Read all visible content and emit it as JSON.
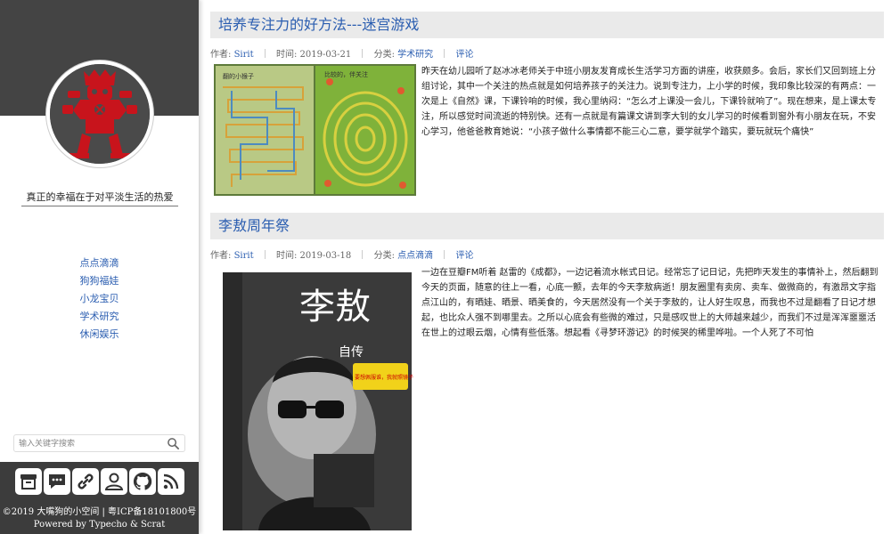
{
  "sidebar": {
    "tagline": "真正的幸福在于对平淡生活的热爱",
    "nav": [
      "点点滴滴",
      "狗狗福娃",
      "小龙宝贝",
      "学术研究",
      "休闲娱乐"
    ],
    "search": {
      "placeholder": "输入关键字搜索"
    },
    "social_icons": [
      "archive-icon",
      "comment-icon",
      "link-icon",
      "user-icon",
      "github-icon",
      "rss-icon"
    ],
    "copyright": "©2019 大嘴狗的小空间 | 粤ICP备18101800号",
    "powered": "Powered by Typecho & Scrat"
  },
  "posts": [
    {
      "title": "培养专注力的好方法---迷宫游戏",
      "author_label": "作者:",
      "author": "Sirit",
      "time_label": "时间:",
      "time": "2019-03-21",
      "category_label": "分类:",
      "category": "学术研究",
      "comment": "评论",
      "excerpt": "昨天在幼儿园听了赵冰冰老师关于中班小朋友发育成长生活学习方面的讲座，收获颇多。会后，家长们又回到班上分组讨论，其中一个关注的热点就是如何培养孩子的关注力。说到专注力，上小学的时候，我印象比较深的有两点：一次是上《自然》课，下课铃响的时候，我心里纳闷：“怎么才上课没一会儿，下课铃就响了”。现在想来，是上课太专注，所以感觉时间流逝的特别快。还有一点就是有篇课文讲到李大钊的女儿学习的时候看到窗外有小朋友在玩，不安心学习，他爸爸教育她说：“小孩子做什么事情都不能三心二意，要学就学个踏实，要玩就玩个痛快”",
      "thumb_texts": [
        "翻的小猴子",
        "比较的，伴关注"
      ]
    },
    {
      "title": "李敖周年祭",
      "author_label": "作者:",
      "author": "Sirit",
      "time_label": "时间:",
      "time": "2019-03-18",
      "category_label": "分类:",
      "category": "点点滴滴",
      "comment": "评论",
      "excerpt": "一边在豆瓣FM听着 赵雷的《成都》，一边记着流水帐式日记。经常忘了记日记，先把昨天发生的事情补上，然后翻到今天的页面，随意的往上一看，心底一颤，去年的今天李敖病逝！朋友圈里有卖房、卖车、做微商的，有激昂文字指点江山的，有晒娃、晒景、晒美食的，今天居然没有一个关于李敖的，让人好生叹息，而我也不过是翻看了日记才想起，也比众人强不到哪里去。之所以心底会有些微的难过，只是感叹世上的大师越来越少，而我们不过是浑浑噩噩活在世上的过眼云烟，心情有些低落。想起看《寻梦环游记》的时候哭的稀里哗啦。一个人死了不可怕",
      "thumb_texts": [
        "李敖",
        "自传",
        "要想佩服谁，我就照镜子"
      ]
    }
  ]
}
